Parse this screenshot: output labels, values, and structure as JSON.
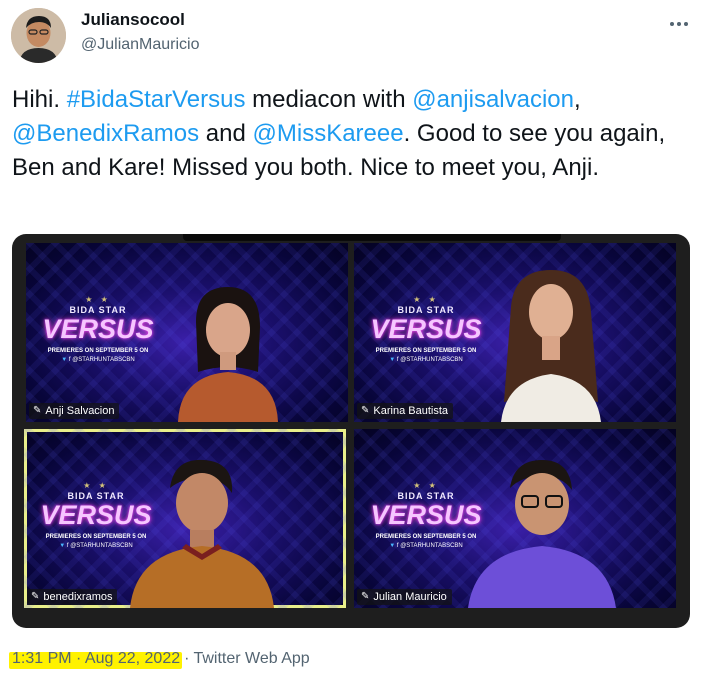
{
  "author": {
    "name": "Juliansocool",
    "handle": "@JulianMauricio"
  },
  "tweet": {
    "t1": "Hihi. ",
    "hashtag": "#BidaStarVersus",
    "t2": " mediacon with ",
    "mention1": "@anjisalvacion",
    "t3": ",",
    "mention2": "@BenedixRamos",
    "t4": " and ",
    "mention3": "@MissKareee",
    "t5": ". Good to see you again, Ben and Kare! Missed you both. Nice to meet you, Anji."
  },
  "media": {
    "logo": {
      "bida": "BIDA STAR",
      "versus": "VERSUS",
      "premieres": "PREMIERES ON SEPTEMBER 5 ON",
      "social": "@STARHUNTABSCBN"
    },
    "participants": [
      {
        "name": "Anji Salvacion",
        "active": false
      },
      {
        "name": "Karina Bautista",
        "active": false
      },
      {
        "name": "benedixramos",
        "active": true
      },
      {
        "name": "Julian Mauricio",
        "active": false
      }
    ]
  },
  "footer": {
    "time_date": "1:31 PM · Aug 22, 2022",
    "separator": "·",
    "source": "Twitter Web App"
  },
  "icons": {
    "more": "more-horizontal-icon",
    "pin": "pin-icon"
  },
  "colors": {
    "link": "#1d9bf0",
    "secondary_text": "#536471",
    "highlight": "#fff200",
    "active_speaker": "#e9ef8a"
  }
}
